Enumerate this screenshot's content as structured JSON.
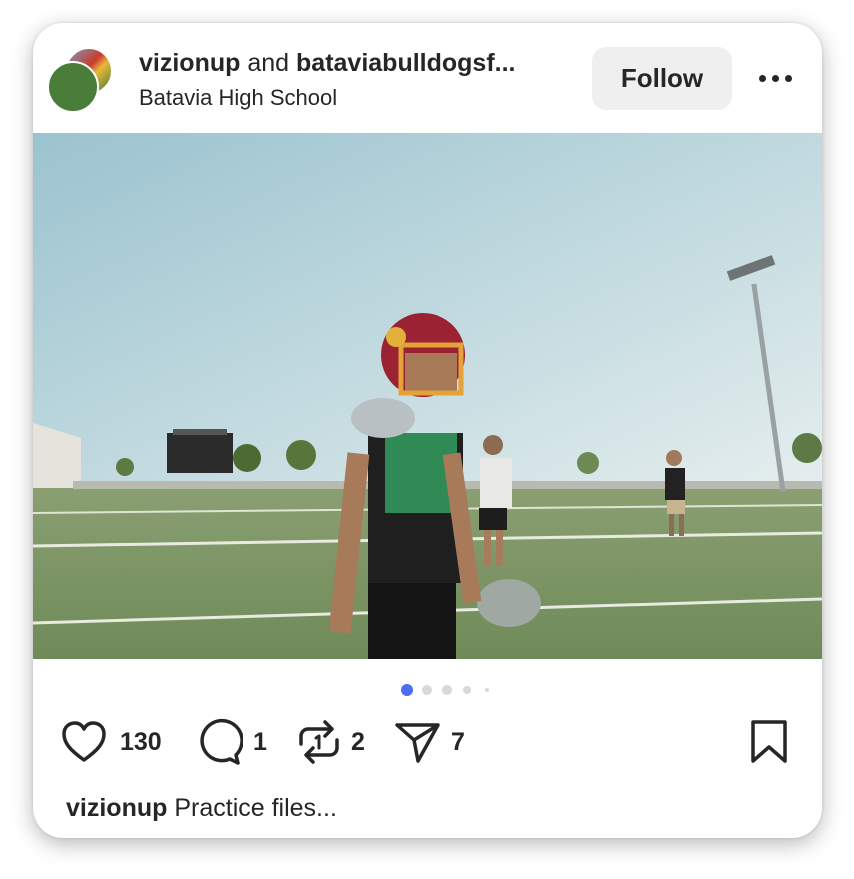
{
  "post": {
    "author_1": "vizionup",
    "connector": "and",
    "author_2": "bataviabulldogsf...",
    "location": "Batavia High School",
    "follow_label": "Follow"
  },
  "carousel": {
    "total_dots": 5,
    "active_index": 0,
    "accent_color": "#4c6ef5"
  },
  "actions": {
    "likes": "130",
    "comments": "1",
    "reposts": "2",
    "shares": "7"
  },
  "caption": {
    "username": "vizionup",
    "text": "Practice files..."
  },
  "icons": [
    "more-options-icon",
    "heart-icon",
    "comment-icon",
    "repost-icon",
    "send-icon",
    "bookmark-icon"
  ]
}
